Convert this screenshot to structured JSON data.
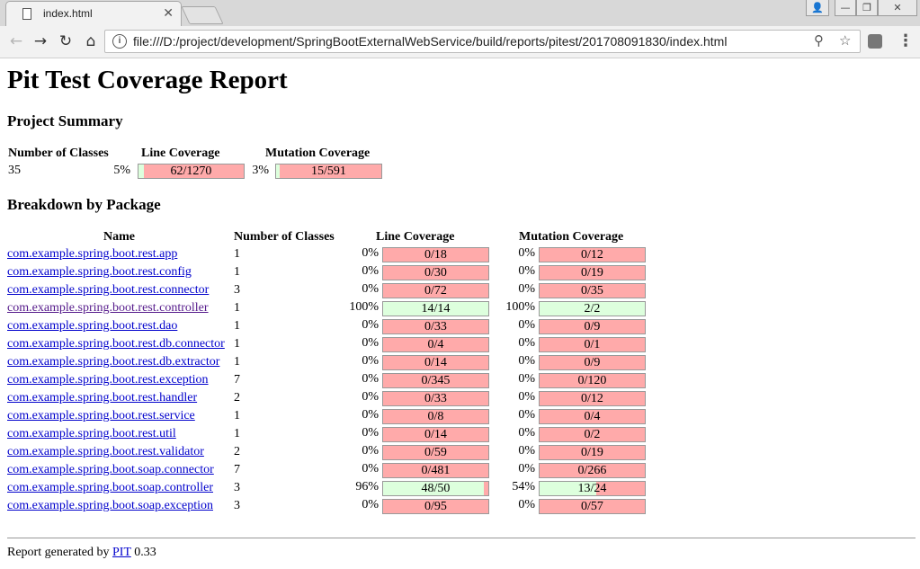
{
  "browser": {
    "tab_title": "index.html",
    "url": "file:///D:/project/development/SpringBootExternalWebService/build/reports/pitest/201708091830/index.html"
  },
  "page": {
    "title": "Pit Test Coverage Report",
    "project_summary_heading": "Project Summary",
    "breakdown_heading": "Breakdown by Package",
    "footer_prefix": "Report generated by ",
    "footer_link": "PIT",
    "footer_version": " 0.33"
  },
  "summary": {
    "headers": [
      "Number of Classes",
      "Line Coverage",
      "Mutation Coverage"
    ],
    "classes": "35",
    "line_pct": "5%",
    "line_text": "62/1270",
    "line_fraction": 0.05,
    "mutation_pct": "3%",
    "mutation_text": "15/591",
    "mutation_fraction": 0.03
  },
  "breakdown": {
    "headers": [
      "Name",
      "Number of Classes",
      "Line Coverage",
      "Mutation Coverage"
    ],
    "rows": [
      {
        "name": "com.example.spring.boot.rest.app",
        "classes": "1",
        "line_pct": "0%",
        "line_text": "0/18",
        "line_fraction": 0,
        "mut_pct": "0%",
        "mut_text": "0/12",
        "mut_fraction": 0
      },
      {
        "name": "com.example.spring.boot.rest.config",
        "classes": "1",
        "line_pct": "0%",
        "line_text": "0/30",
        "line_fraction": 0,
        "mut_pct": "0%",
        "mut_text": "0/19",
        "mut_fraction": 0
      },
      {
        "name": "com.example.spring.boot.rest.connector",
        "classes": "3",
        "line_pct": "0%",
        "line_text": "0/72",
        "line_fraction": 0,
        "mut_pct": "0%",
        "mut_text": "0/35",
        "mut_fraction": 0
      },
      {
        "name": "com.example.spring.boot.rest.controller",
        "classes": "1",
        "line_pct": "100%",
        "line_text": "14/14",
        "line_fraction": 1,
        "mut_pct": "100%",
        "mut_text": "2/2",
        "mut_fraction": 1
      },
      {
        "name": "com.example.spring.boot.rest.dao",
        "classes": "1",
        "line_pct": "0%",
        "line_text": "0/33",
        "line_fraction": 0,
        "mut_pct": "0%",
        "mut_text": "0/9",
        "mut_fraction": 0
      },
      {
        "name": "com.example.spring.boot.rest.db.connector",
        "classes": "1",
        "line_pct": "0%",
        "line_text": "0/4",
        "line_fraction": 0,
        "mut_pct": "0%",
        "mut_text": "0/1",
        "mut_fraction": 0
      },
      {
        "name": "com.example.spring.boot.rest.db.extractor",
        "classes": "1",
        "line_pct": "0%",
        "line_text": "0/14",
        "line_fraction": 0,
        "mut_pct": "0%",
        "mut_text": "0/9",
        "mut_fraction": 0
      },
      {
        "name": "com.example.spring.boot.rest.exception",
        "classes": "7",
        "line_pct": "0%",
        "line_text": "0/345",
        "line_fraction": 0,
        "mut_pct": "0%",
        "mut_text": "0/120",
        "mut_fraction": 0
      },
      {
        "name": "com.example.spring.boot.rest.handler",
        "classes": "2",
        "line_pct": "0%",
        "line_text": "0/33",
        "line_fraction": 0,
        "mut_pct": "0%",
        "mut_text": "0/12",
        "mut_fraction": 0
      },
      {
        "name": "com.example.spring.boot.rest.service",
        "classes": "1",
        "line_pct": "0%",
        "line_text": "0/8",
        "line_fraction": 0,
        "mut_pct": "0%",
        "mut_text": "0/4",
        "mut_fraction": 0
      },
      {
        "name": "com.example.spring.boot.rest.util",
        "classes": "1",
        "line_pct": "0%",
        "line_text": "0/14",
        "line_fraction": 0,
        "mut_pct": "0%",
        "mut_text": "0/2",
        "mut_fraction": 0
      },
      {
        "name": "com.example.spring.boot.rest.validator",
        "classes": "2",
        "line_pct": "0%",
        "line_text": "0/59",
        "line_fraction": 0,
        "mut_pct": "0%",
        "mut_text": "0/19",
        "mut_fraction": 0
      },
      {
        "name": "com.example.spring.boot.soap.connector",
        "classes": "7",
        "line_pct": "0%",
        "line_text": "0/481",
        "line_fraction": 0,
        "mut_pct": "0%",
        "mut_text": "0/266",
        "mut_fraction": 0
      },
      {
        "name": "com.example.spring.boot.soap.controller",
        "classes": "3",
        "line_pct": "96%",
        "line_text": "48/50",
        "line_fraction": 0.96,
        "mut_pct": "54%",
        "mut_text": "13/24",
        "mut_fraction": 0.54
      },
      {
        "name": "com.example.spring.boot.soap.exception",
        "classes": "3",
        "line_pct": "0%",
        "line_text": "0/95",
        "line_fraction": 0,
        "mut_pct": "0%",
        "mut_text": "0/57",
        "mut_fraction": 0
      }
    ]
  },
  "colors": {
    "covered": "#ddffdd",
    "uncovered": "#ffaaaa",
    "link": "#0000cc"
  }
}
